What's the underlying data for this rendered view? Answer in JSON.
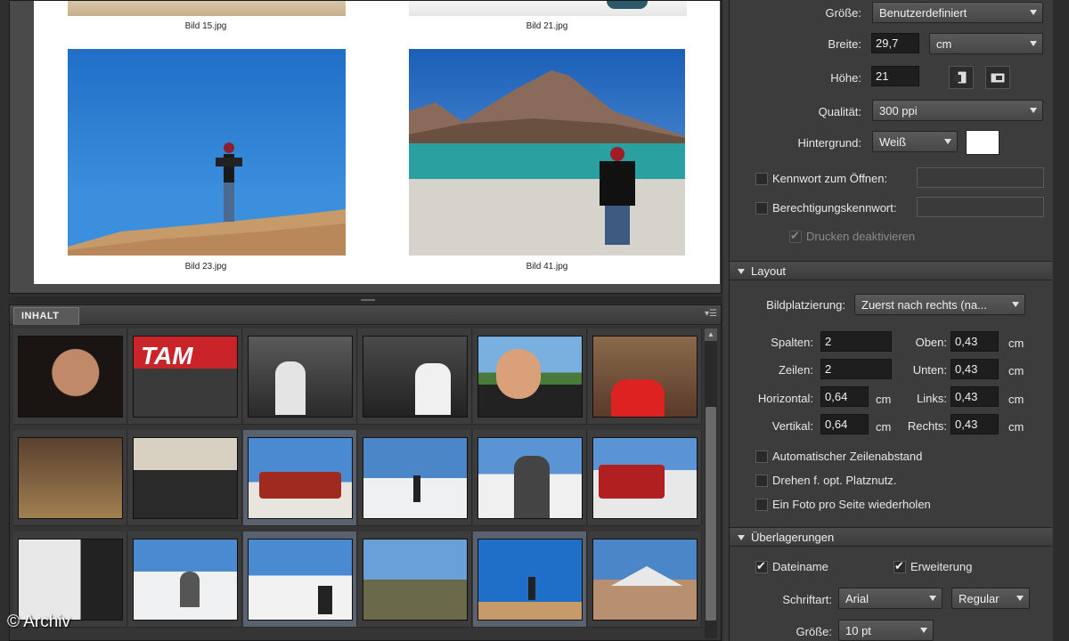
{
  "preview": {
    "captions": [
      "Bild 15.jpg",
      "Bild 21.jpg",
      "Bild 23.jpg",
      "Bild 41.jpg"
    ]
  },
  "content_panel": {
    "tab_label": "INHALT",
    "menu_icon": "panel-menu-icon",
    "thumbnail_count": 18
  },
  "settings": {
    "groesse_label": "Größe:",
    "groesse_value": "Benutzerdefiniert",
    "breite_label": "Breite:",
    "breite_value": "29,7",
    "breite_unit": "cm",
    "hoehe_label": "Höhe:",
    "hoehe_value": "21",
    "qualitaet_label": "Qualität:",
    "qualitaet_value": "300 ppi",
    "hintergrund_label": "Hintergrund:",
    "hintergrund_value": "Weiß",
    "hintergrund_color": "#ffffff",
    "kennwort_label": "Kennwort zum Öffnen:",
    "berechtigung_label": "Berechtigungskennwort:",
    "drucken_label": "Drucken deaktivieren"
  },
  "layout": {
    "section_title": "Layout",
    "bildplatzierung_label": "Bildplatzierung:",
    "bildplatzierung_value": "Zuerst nach rechts (na...",
    "spalten_label": "Spalten:",
    "spalten_value": "2",
    "zeilen_label": "Zeilen:",
    "zeilen_value": "2",
    "horizontal_label": "Horizontal:",
    "horizontal_value": "0,64",
    "vertikal_label": "Vertikal:",
    "vertikal_value": "0,64",
    "oben_label": "Oben:",
    "oben_value": "0,43",
    "unten_label": "Unten:",
    "unten_value": "0,43",
    "links_label": "Links:",
    "links_value": "0,43",
    "rechts_label": "Rechts:",
    "rechts_value": "0,43",
    "unit": "cm",
    "auto_zeilen_label": "Automatischer Zeilenabstand",
    "drehen_label": "Drehen f. opt. Platznutz.",
    "ein_foto_label": "Ein Foto pro Seite wiederholen"
  },
  "overlays": {
    "section_title": "Überlagerungen",
    "dateiname_label": "Dateiname",
    "erweiterung_label": "Erweiterung",
    "schriftart_label": "Schriftart:",
    "schriftart_value": "Arial",
    "schriftstil_value": "Regular",
    "groesse_label": "Größe:",
    "groesse_value": "10 pt"
  },
  "watermark": "© Archiv"
}
